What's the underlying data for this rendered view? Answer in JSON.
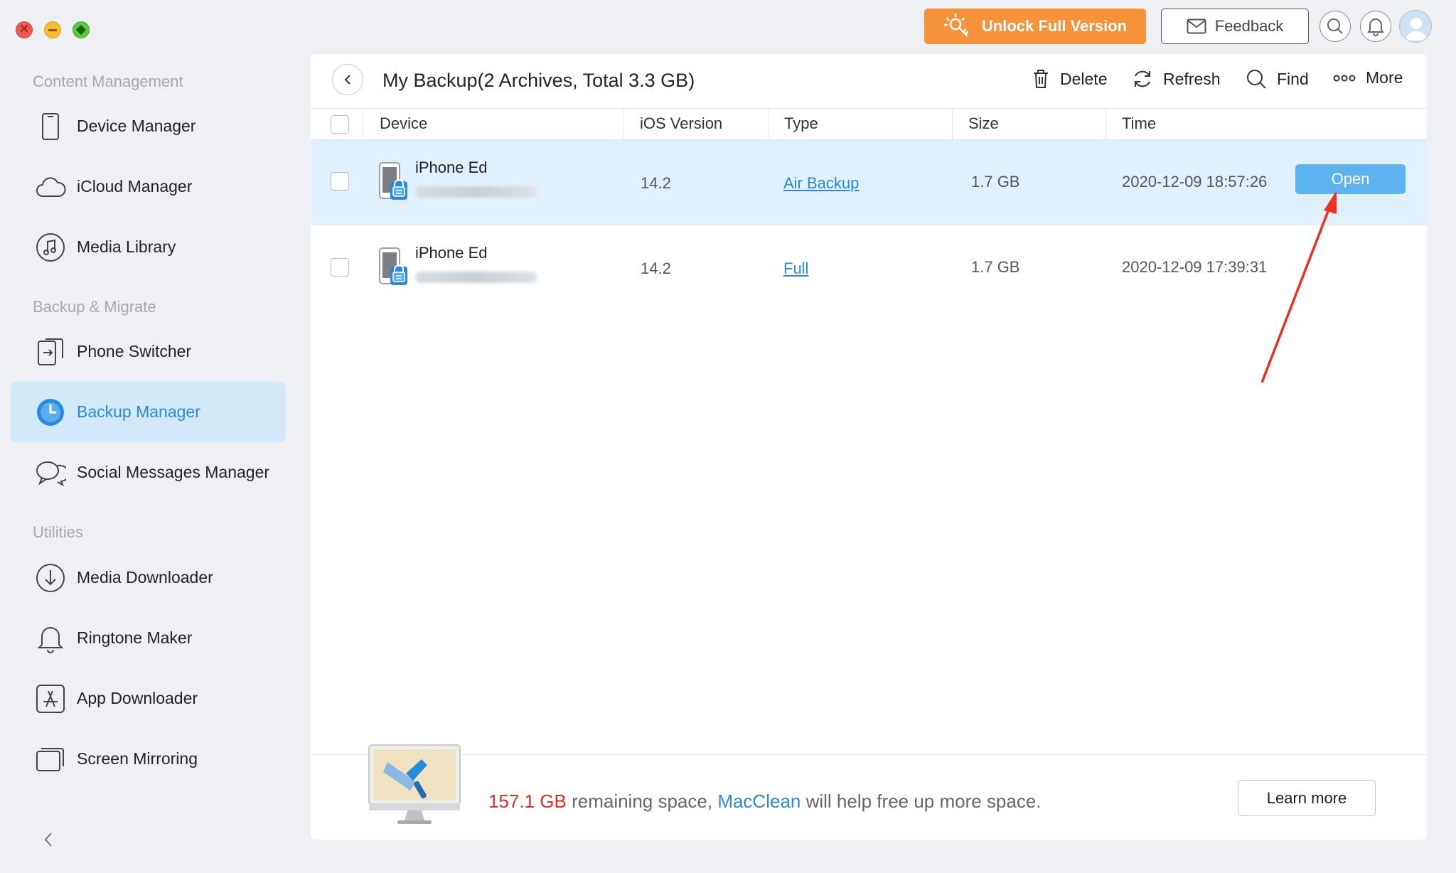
{
  "toolbar": {
    "unlock_label": "Unlock Full Version",
    "feedback_label": "Feedback"
  },
  "sidebar": {
    "sections": [
      {
        "title": "Content Management"
      },
      {
        "title": "Backup & Migrate"
      },
      {
        "title": "Utilities"
      }
    ],
    "items": [
      {
        "label": "Device Manager",
        "icon": "phone-icon"
      },
      {
        "label": "iCloud Manager",
        "icon": "cloud-icon"
      },
      {
        "label": "Media Library",
        "icon": "music-icon"
      },
      {
        "label": "Phone Switcher",
        "icon": "switch-icon"
      },
      {
        "label": "Backup Manager",
        "icon": "clock-icon",
        "active": true
      },
      {
        "label": "Social Messages Manager",
        "icon": "chat-icon"
      },
      {
        "label": "Media Downloader",
        "icon": "download-icon"
      },
      {
        "label": "Ringtone Maker",
        "icon": "bell-icon"
      },
      {
        "label": "App Downloader",
        "icon": "app-store-icon"
      },
      {
        "label": "Screen Mirroring",
        "icon": "screen-icon"
      }
    ]
  },
  "main": {
    "title": "My Backup(2 Archives, Total  3.3 GB)",
    "actions": {
      "delete": "Delete",
      "refresh": "Refresh",
      "find": "Find",
      "more": "More"
    },
    "columns": [
      "Device",
      "iOS Version",
      "Type",
      "Size",
      "Time"
    ],
    "rows": [
      {
        "device": "iPhone Ed",
        "ios": "14.2",
        "type": "Air Backup",
        "size": "1.7 GB",
        "time": "2020-12-09 18:57:26",
        "action": "Open",
        "selected": true
      },
      {
        "device": "iPhone Ed",
        "ios": "14.2",
        "type": "Full",
        "size": "1.7 GB",
        "time": "2020-12-09 17:39:31"
      }
    ]
  },
  "footer": {
    "remaining": "157.1 GB",
    "text_mid": " remaining space, ",
    "brand": "MacClean",
    "text_end": " will help free up more space.",
    "learn_more": "Learn more"
  },
  "colors": {
    "accent": "#2a8ad9",
    "unlock": "#f5923a",
    "open_button": "#5db3ee",
    "selected_row": "#e1f1fc",
    "warning": "#e02b2b"
  }
}
